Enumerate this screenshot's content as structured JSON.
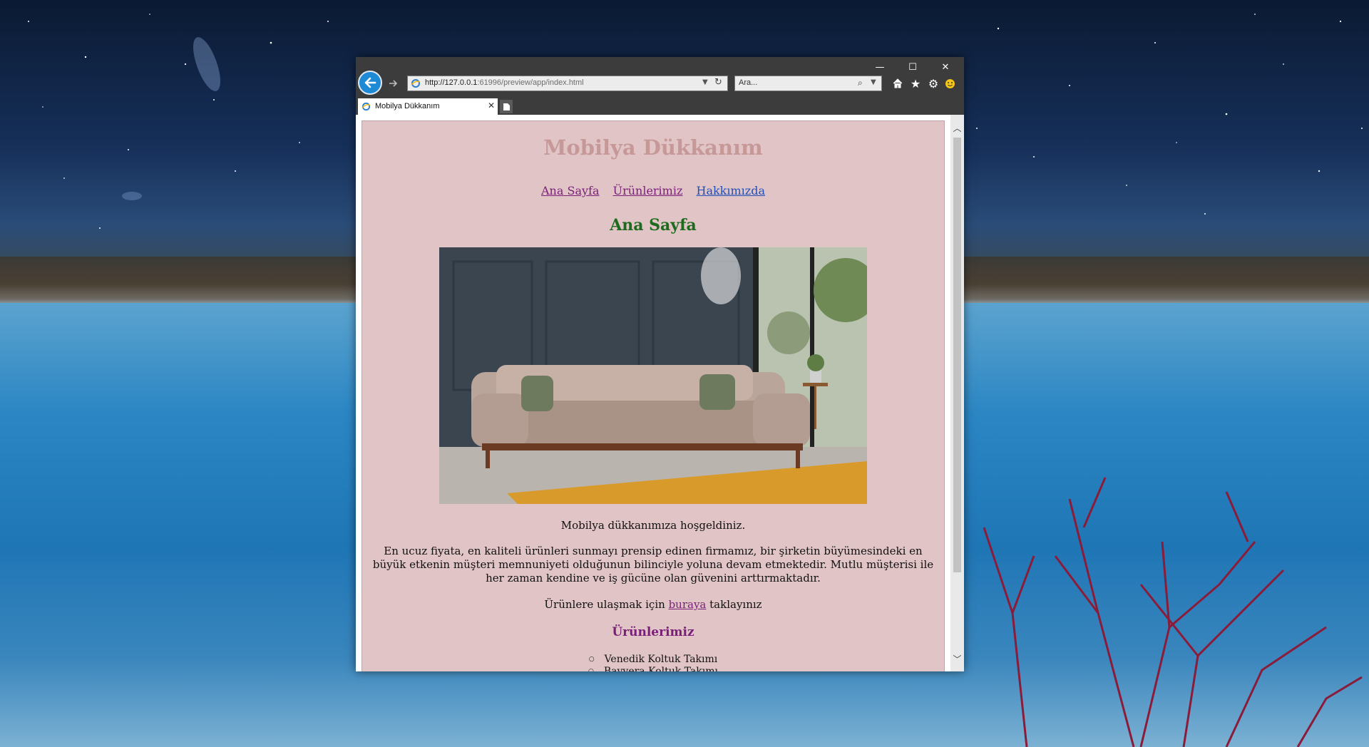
{
  "browser": {
    "address_url_host": "http://127.0.0.1",
    "address_url_rest": ":61996/preview/app/index.html",
    "search_placeholder": "Ara...",
    "tab_title": "Mobilya Dükkanım",
    "window_controls": {
      "minimize": "—",
      "maximize": "☐",
      "close": "✕"
    },
    "icons": [
      "back-arrow-icon",
      "forward-arrow-icon",
      "ie-page-icon",
      "refresh-icon",
      "search-icon",
      "home-icon",
      "favorites-star-icon",
      "settings-gear-icon",
      "smiley-feedback-icon",
      "new-tab-icon"
    ]
  },
  "page": {
    "site_title": "Mobilya Dükkanım",
    "nav": [
      {
        "label": "Ana Sayfa"
      },
      {
        "label": "Ürünlerimiz"
      },
      {
        "label": "Hakkımızda"
      }
    ],
    "section_heading": "Ana Sayfa",
    "welcome": "Mobilya dükkanımıza hoşgeldiniz.",
    "about": "En ucuz fiyata, en kaliteli ürünleri sunmayı prensip edinen firmamız, bir şirketin büyümesindeki en büyük etkenin müşteri memnuniyeti olduğunun bilinciyle yoluna devam etmektedir. Mutlu müşterisi ile her zaman kendine ve iş gücüne olan güvenini arttırmaktadır.",
    "products_prefix": "Ürünlere ulaşmak için",
    "products_link": "buraya",
    "products_suffix": "taklayınız",
    "products_heading": "Ürünlerimiz",
    "products": [
      "Venedik Koltuk Takımı",
      "Bavyera Koltuk Takımı"
    ]
  },
  "colors": {
    "page_bg": "#e0c4c6",
    "site_title": "#c79898",
    "section_heading": "#1e6b1e",
    "visited_link": "#7a1f79",
    "link": "#1f4fb7",
    "chrome": "#3c3c3c",
    "back_button": "#1e8ad6"
  }
}
